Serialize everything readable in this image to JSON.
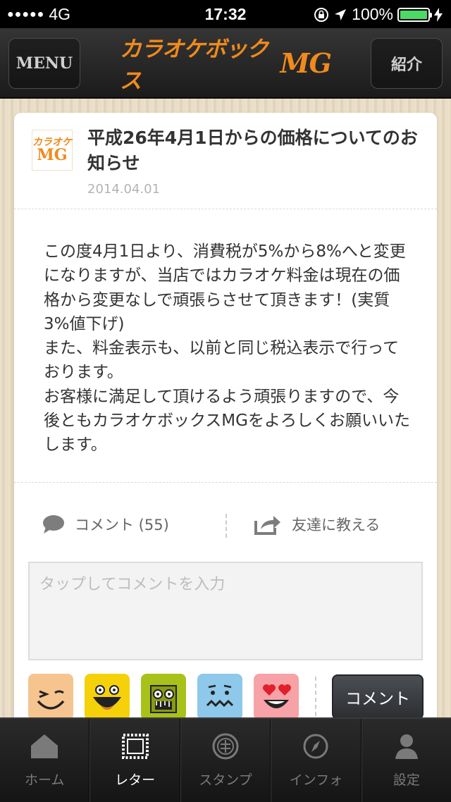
{
  "status_bar": {
    "carrier": "4G",
    "time": "17:32",
    "battery": "100%"
  },
  "header": {
    "menu_label": "MENU",
    "logo_text": "カラオケボックス",
    "logo_mg": "MG",
    "intro_label": "紹介"
  },
  "post": {
    "thumb_top": "カラオケ",
    "thumb_bottom": "MG",
    "title": "平成26年4月1日からの価格についてのお知らせ",
    "date": "2014.04.01",
    "body": "この度4月1日より、消費税が5%から8%へと変更になりますが、当店ではカラオケ料金は現在の価格から変更なしで頑張らさせて頂きます！(実質3%値下げ)\nまた、料金表示も、以前と同じ税込表示で行っております。\nお客様に満足して頂けるよう頑張りますので、今後ともカラオケボックスMGをよろしくお願いいたします。"
  },
  "actions": {
    "comment_label": "コメント (55)",
    "share_label": "友達に教える"
  },
  "comment_form": {
    "placeholder": "タップしてコメントを入力",
    "submit_label": "コメント"
  },
  "stamps": [
    {
      "name": "wink-face",
      "bg": "#f6c48f"
    },
    {
      "name": "laughing-face",
      "bg": "#f5d10a"
    },
    {
      "name": "zombie-face",
      "bg": "#a9c21a"
    },
    {
      "name": "worried-face",
      "bg": "#8ec8ea"
    },
    {
      "name": "heart-eyes-face",
      "bg": "#f7a2a6"
    }
  ],
  "tabbar": {
    "items": [
      {
        "label": "ホーム",
        "icon": "home-icon"
      },
      {
        "label": "レター",
        "icon": "letter-icon"
      },
      {
        "label": "スタンプ",
        "icon": "stamp-icon"
      },
      {
        "label": "インフォ",
        "icon": "compass-icon"
      },
      {
        "label": "設定",
        "icon": "user-icon"
      }
    ],
    "active_index": 1
  },
  "colors": {
    "brand": "#f08a1c",
    "header_bg": "#1f1f1f",
    "wood_bg": "#e9dcc4"
  }
}
